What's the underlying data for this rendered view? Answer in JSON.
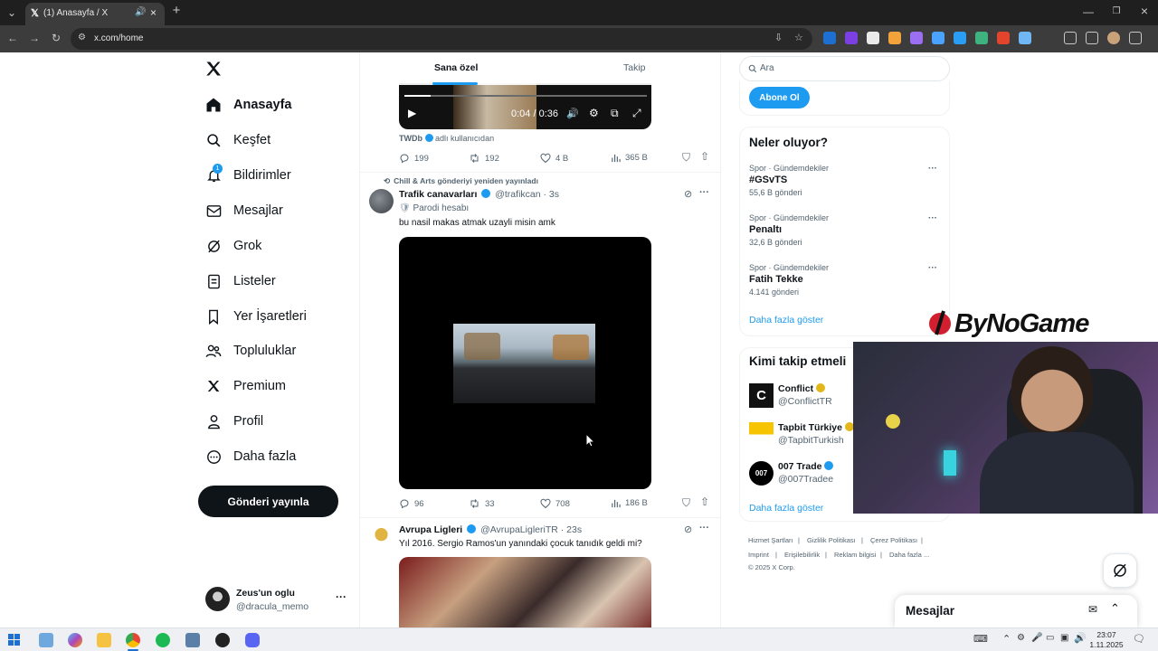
{
  "browser": {
    "tab_title": "(1) Anasayfa / X",
    "url": "x.com/home",
    "ext_colors": [
      "#1d6fd1",
      "#7b3fe4",
      "#eaeaea",
      "#f2a33a",
      "#9c6ef0",
      "#4aa3ff",
      "#2a9df4",
      "#3fb37f",
      "#e2452b",
      "#6fb7f5"
    ]
  },
  "sidebar": {
    "items": [
      {
        "label": "Anasayfa",
        "icon": "home-icon"
      },
      {
        "label": "Keşfet",
        "icon": "search-icon"
      },
      {
        "label": "Bildirimler",
        "icon": "bell-icon",
        "badge": "1"
      },
      {
        "label": "Mesajlar",
        "icon": "mail-icon"
      },
      {
        "label": "Grok",
        "icon": "grok-icon"
      },
      {
        "label": "Listeler",
        "icon": "list-icon"
      },
      {
        "label": "Yer İşaretleri",
        "icon": "bookmark-icon"
      },
      {
        "label": "Topluluklar",
        "icon": "people-icon"
      },
      {
        "label": "Premium",
        "icon": "x-logo-icon"
      },
      {
        "label": "Profil",
        "icon": "person-icon"
      },
      {
        "label": "Daha fazla",
        "icon": "more-circle-icon"
      }
    ],
    "post_button": "Gönderi yayınla",
    "account": {
      "name": "Zeus'un oglu",
      "handle": "@dracula_memo"
    }
  },
  "feed": {
    "tabs": [
      "Sana özel",
      "Takip"
    ],
    "post0": {
      "time": "0:04 / 0:36",
      "source": "TWDb",
      "source_suffix": "adlı kullanıcıdan",
      "replies": "199",
      "reposts": "192",
      "likes": "4 B",
      "views": "365 B"
    },
    "post1": {
      "repost_note": "Chill & Arts gönderiyi yeniden yayınladı",
      "name": "Trafik canavarları",
      "handle": "@trafikcan · 3s",
      "parody": "Parodi hesabı",
      "text": "bu nasil makas atmak uzayli misin amk",
      "replies": "96",
      "reposts": "33",
      "likes": "708",
      "views": "186 B"
    },
    "post2": {
      "name": "Avrupa Ligleri",
      "handle": "@AvrupaLigleriTR · 23s",
      "text": "Yıl 2016. Sergio Ramos'un yanındaki çocuk tanıdık geldi mi?"
    }
  },
  "right": {
    "search_placeholder": "Ara",
    "subscribe": "Abone Ol",
    "trends_title": "Neler oluyor?",
    "trends": [
      {
        "category": "Spor · Gündemdekiler",
        "title": "#GSvTS",
        "count": "55,6 B gönderi"
      },
      {
        "category": "Spor · Gündemdekiler",
        "title": "Penaltı",
        "count": "32,6 B gönderi"
      },
      {
        "category": "Spor · Gündemdekiler",
        "title": "Fatih Tekke",
        "count": "4.141 gönderi"
      }
    ],
    "show_more": "Daha fazla göster",
    "who_title": "Kimi takip etmeli",
    "who": [
      {
        "name": "Conflict",
        "handle": "@ConflictTR"
      },
      {
        "name": "Tapbit Türkiye",
        "handle": "@TapbitTurkish"
      },
      {
        "name": "007 Trade",
        "handle": "@007Tradee"
      }
    ],
    "who_more": "Daha fazla göster",
    "footer": [
      "Hizmet Şartları",
      "Gizlilik Politikası",
      "Çerez Politikası",
      "Imprint",
      "Erişilebilirlik",
      "Reklam bilgisi",
      "Daha fazla ..."
    ],
    "copyright": "© 2025 X Corp.",
    "messages_label": "Mesajlar"
  },
  "overlay": {
    "brand": "ByNoGame"
  },
  "taskbar": {
    "time": "23:07",
    "date": "1.11.2025"
  }
}
